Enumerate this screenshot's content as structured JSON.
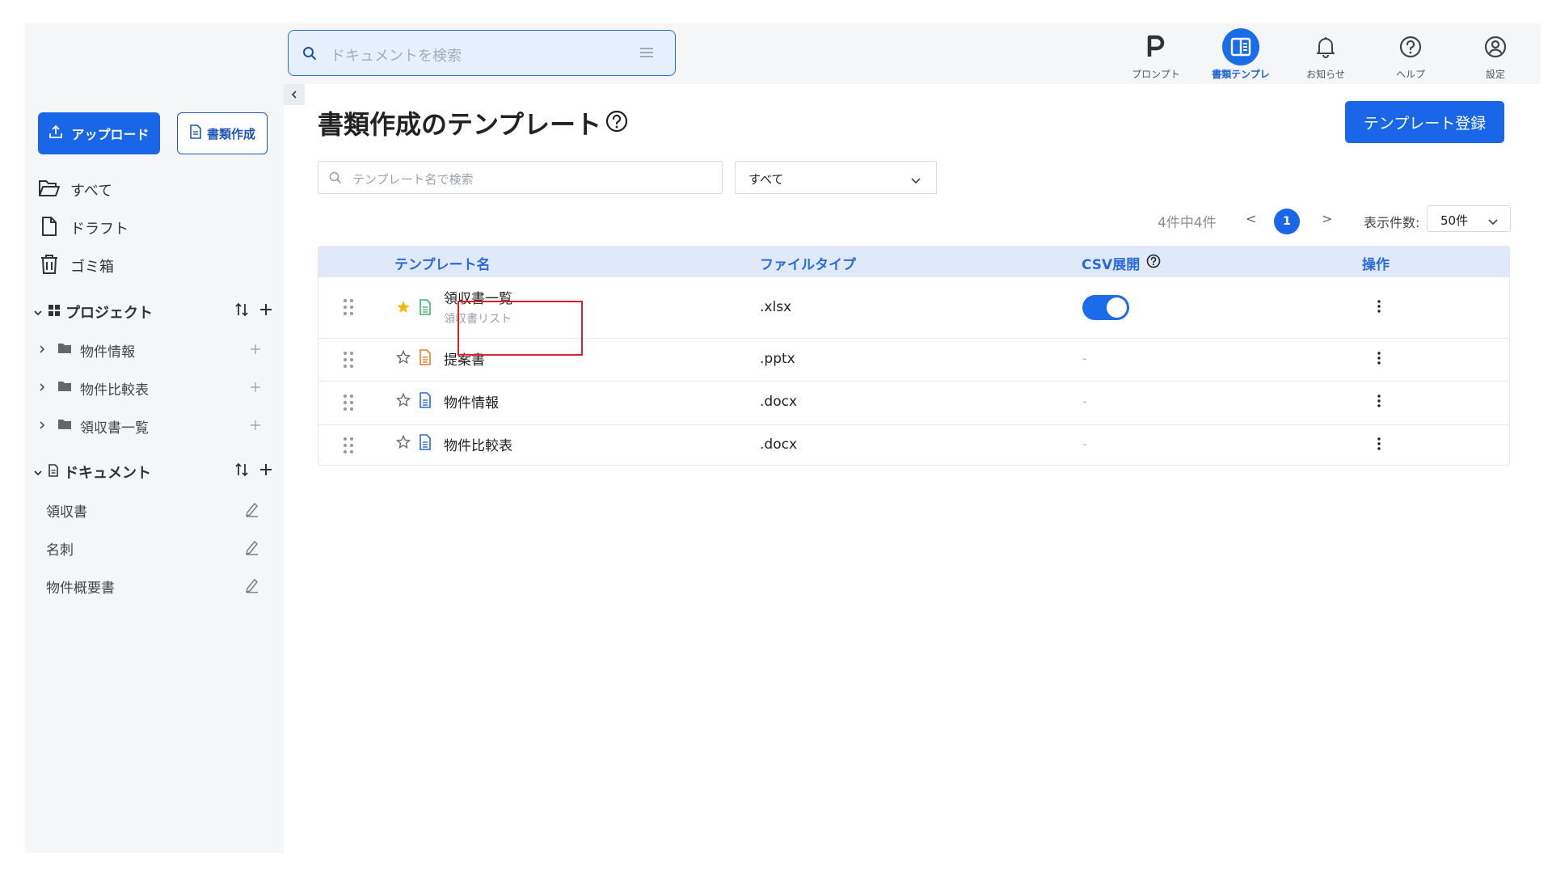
{
  "header": {
    "search_placeholder": "ドキュメントを検索",
    "nav": [
      {
        "label": "プロンプト",
        "icon": "p-letter-icon",
        "active": false
      },
      {
        "label": "書類テンプレ",
        "icon": "template-icon",
        "active": true
      },
      {
        "label": "お知らせ",
        "icon": "bell-icon",
        "active": false
      },
      {
        "label": "ヘルプ",
        "icon": "help-icon",
        "active": false
      },
      {
        "label": "設定",
        "icon": "user-settings-icon",
        "active": false
      }
    ]
  },
  "sidebar": {
    "upload_label": "アップロード",
    "create_label": "書類作成",
    "items": [
      {
        "label": "すべて",
        "icon": "folder-open-icon"
      },
      {
        "label": "ドラフト",
        "icon": "file-icon"
      },
      {
        "label": "ゴミ箱",
        "icon": "trash-icon"
      }
    ],
    "projects": {
      "title": "プロジェクト",
      "items": [
        {
          "label": "物件情報"
        },
        {
          "label": "物件比較表"
        },
        {
          "label": "領収書一覧"
        }
      ]
    },
    "documents": {
      "title": "ドキュメント",
      "items": [
        {
          "label": "領収書"
        },
        {
          "label": "名刺"
        },
        {
          "label": "物件概要書"
        }
      ]
    }
  },
  "main": {
    "title": "書類作成のテンプレート",
    "register_label": "テンプレート登録",
    "search_placeholder": "テンプレート名で検索",
    "filter_value": "すべて",
    "pagination": {
      "count_text": "4件中4件",
      "prev": "<",
      "current": "1",
      "next": ">",
      "size_label": "表示件数:",
      "size_value": "50件"
    },
    "table": {
      "headers": {
        "name": "テンプレート名",
        "filetype": "ファイルタイプ",
        "csv": "CSV展開",
        "actions": "操作"
      },
      "rows": [
        {
          "name": "領収書一覧",
          "subtitle": "領収書リスト",
          "filetype": ".xlsx",
          "csv": "on",
          "starred": true,
          "icon_color": "#3bb26b"
        },
        {
          "name": "提案書",
          "subtitle": "",
          "filetype": ".pptx",
          "csv": "-",
          "starred": false,
          "icon_color": "#f07a26"
        },
        {
          "name": "物件情報",
          "subtitle": "",
          "filetype": ".docx",
          "csv": "-",
          "starred": false,
          "icon_color": "#2a6ad8"
        },
        {
          "name": "物件比較表",
          "subtitle": "",
          "filetype": ".docx",
          "csv": "-",
          "starred": false,
          "icon_color": "#2a6ad8"
        }
      ]
    }
  },
  "colors": {
    "accent": "#1a66e8",
    "highlight": "#d9232b",
    "star": "#f5b800"
  }
}
